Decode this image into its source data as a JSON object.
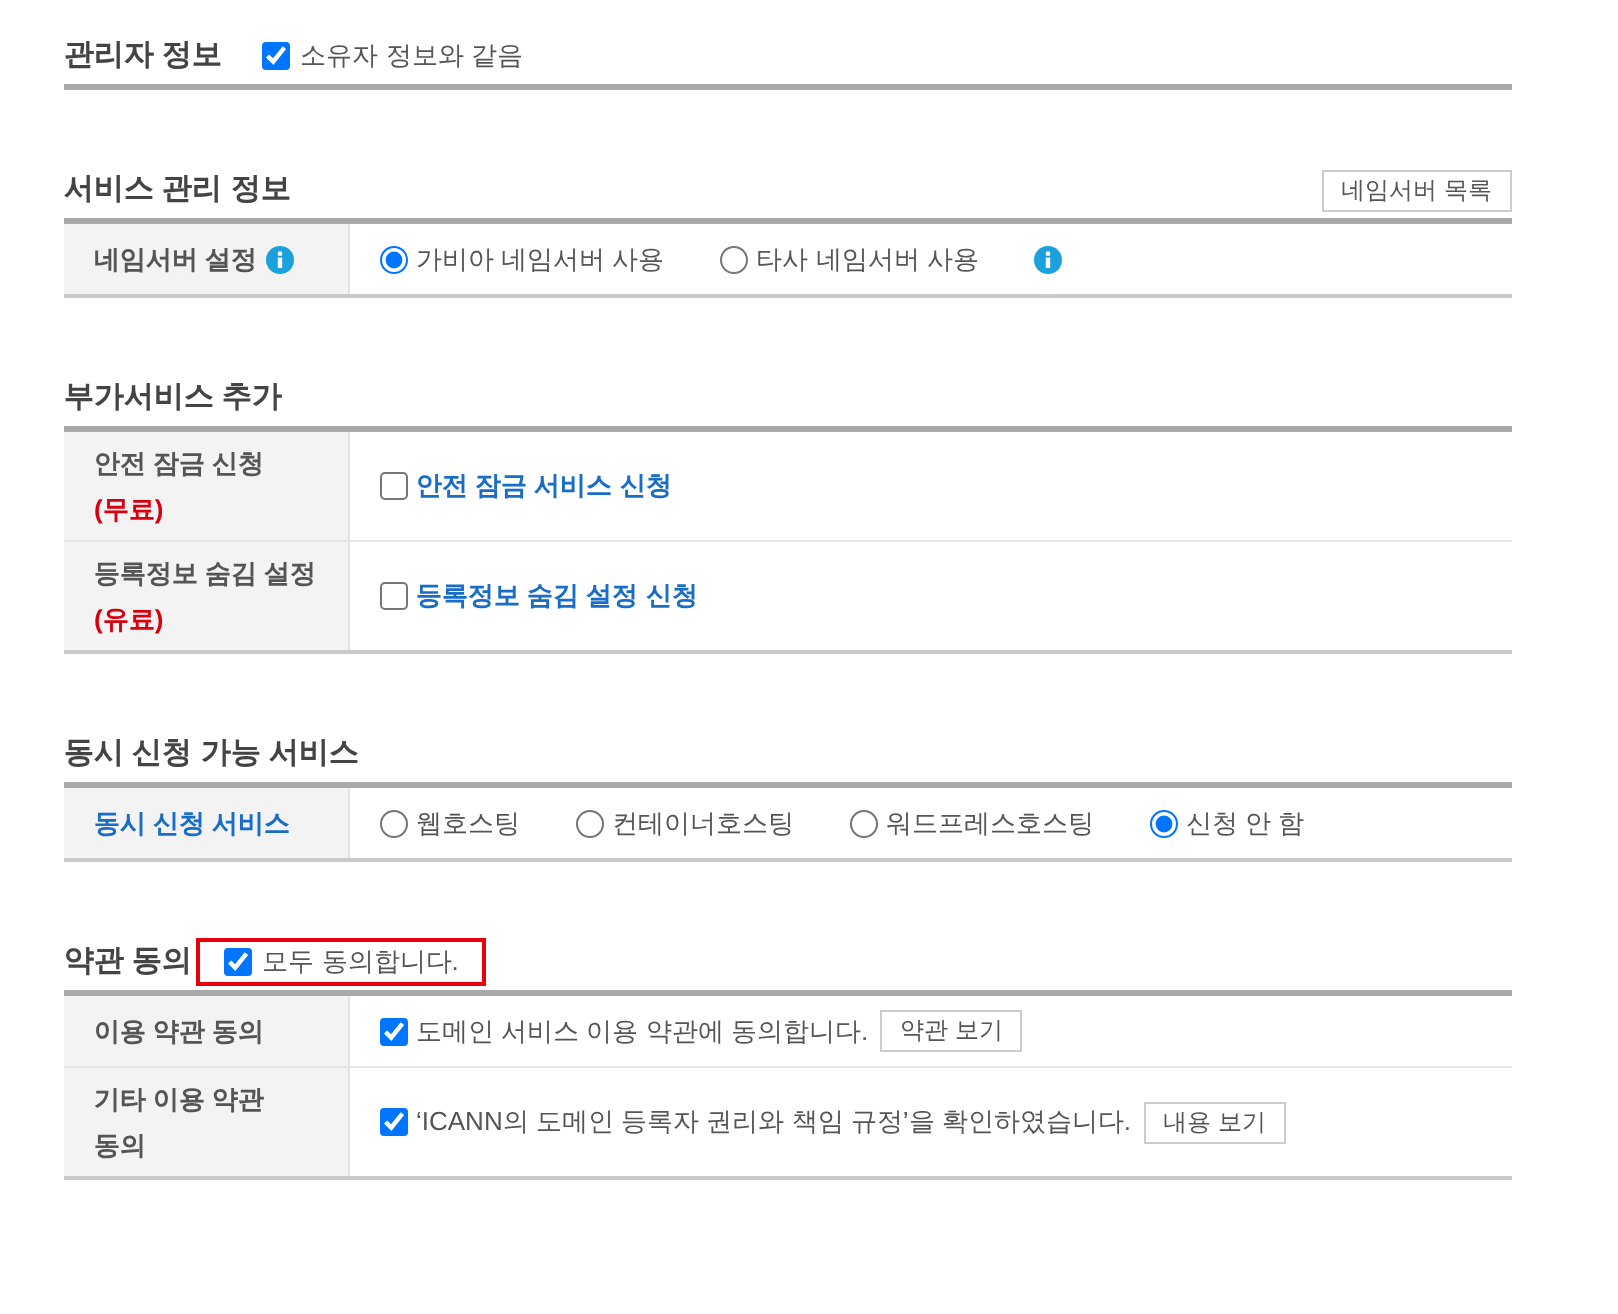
{
  "sections": [
    {
      "title": "관리자 정보",
      "title_checkbox": {
        "label": "소유자 정보와 같음",
        "checked": true
      }
    },
    {
      "title": "서비스 관리 정보",
      "button": "네임서버 목록",
      "rows": [
        {
          "label": "네임서버 설정",
          "label_info_icon": true,
          "label_accent": false,
          "kind": "radio",
          "options": [
            {
              "label": "가비아 네임서버 사용",
              "selected": true
            },
            {
              "label": "타사 네임서버 사용",
              "selected": false
            }
          ],
          "trailing_info_icon": true
        }
      ]
    },
    {
      "title": "부가서비스 추가",
      "rows": [
        {
          "label": "안전 잠금 신청",
          "note": "(무료)",
          "label_accent": false,
          "kind": "service",
          "options": [
            {
              "label": "안전 잠금 서비스 신청",
              "checked": false
            }
          ]
        },
        {
          "label": "등록정보 숨김 설정",
          "note": "(유료)",
          "label_accent": false,
          "kind": "service",
          "options": [
            {
              "label": "등록정보 숨김 설정 신청",
              "checked": false
            }
          ]
        }
      ]
    },
    {
      "title": "동시 신청 가능 서비스",
      "rows": [
        {
          "label": "동시 신청 서비스",
          "label_accent": true,
          "kind": "radio",
          "options": [
            {
              "label": "웹호스팅",
              "selected": false
            },
            {
              "label": "컨테이너호스팅",
              "selected": false
            },
            {
              "label": "워드프레스호스팅",
              "selected": false
            },
            {
              "label": "신청 안 함",
              "selected": true
            }
          ]
        }
      ]
    },
    {
      "title": "약관 동의",
      "title_checkbox": {
        "label": "모두 동의합니다.",
        "checked": true,
        "highlighted": true
      },
      "rows": [
        {
          "label": "이용 약관 동의",
          "label_accent": false,
          "kind": "agreement",
          "options": [
            {
              "label": "도메인 서비스 이용 약관에 동의합니다.",
              "checked": true
            }
          ],
          "button": "약관 보기"
        },
        {
          "label": "기타 이용 약관 동의",
          "label_accent": false,
          "kind": "agreement",
          "options": [
            {
              "label": "‘ICANN의 도메인 등록자 권리와 책임 규정’을 확인하였습니다.",
              "checked": true
            }
          ],
          "button": "내용 보기"
        }
      ]
    }
  ]
}
